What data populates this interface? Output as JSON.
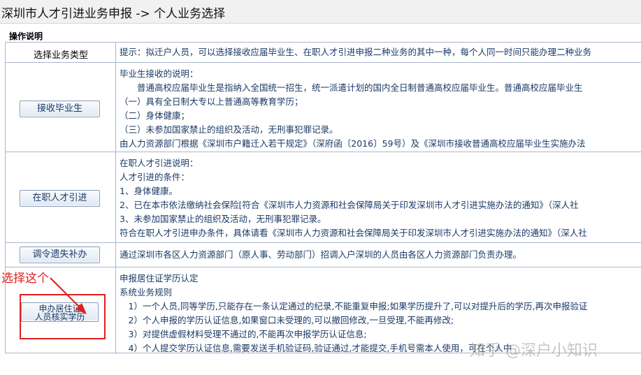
{
  "page": {
    "title": "深圳市人才引进业务申报 -> 个人业务选择",
    "section_label": "操作说明"
  },
  "header_row": {
    "left": "选择业务类型",
    "right": "提示：拟迁户人员，可以选择接收应届毕业生、在职人才引进申报二种业务的其中一种，每个人同一时间只能办理二种业务"
  },
  "rows": [
    {
      "button": "接收毕业生",
      "lines": [
        "毕业生接收的说明：",
        "　　普通高校应届毕业生是指纳入全国统一招生，统一派遣计划的国内全日制普通高校应届毕业生。普通高校应届毕业生",
        "（一）具有全日制大专以上普通高等教育学历；",
        "（二）身体健康；",
        "（三）未参加国家禁止的组织及活动，无刑事犯罪记录。",
        "由人力资源部门根据《深圳市户籍迁入若干规定》（深府函〔2016〕59号）及《深圳市接收普通高校应届毕业生实施办法"
      ]
    },
    {
      "button": "在职人才引进",
      "lines": [
        "在职人才引进说明：",
        "人才引进的条件：",
        "1、身体健康。",
        "2、已在本市依法缴纳社会保险[符合《深圳市人力资源和社会保障局关于印发深圳市人才引进实施办法的通知》（深人社",
        "3、未参加国家禁止的组织及活动，无刑事犯罪记录。",
        "符合在职人才引进申办条件，具体请看《深圳市人力资源和社会保障局关于印发深圳市人才引进实施办法的通知》（深人社"
      ]
    },
    {
      "button": "调令遗失补办",
      "lines": [
        "通过深圳市各区人力资源部门（原人事、劳动部门）招调入户深圳的人员由各区人力资源部门负责办理。"
      ]
    },
    {
      "button_line1": "申办居住证",
      "button_line2": "人员核实学历",
      "lines": [
        "申报居住证学历认定",
        "系统业务规则",
        "　1）一个人员,同等学历,只能存在一条认定通过的纪录,不能重复申报;如果学历提升了,可以对提升后的学历,再次申报验证",
        "　2）个人申报的学历认证信息,如果窗口未受理的,可以撤回修改,一旦受理,不能再修改;",
        "　3）对提供虚假材料受理不通过的,不能再次申报学历认证信息;",
        "　4）个人提交学历认证信息,需要发送手机验证码,验证通过,才能提交,手机号需本人使用，可在个人中"
      ]
    }
  ],
  "annotation": {
    "text": "选择这个",
    "color": "#e02020"
  },
  "watermark": "知乎 @深户小知识"
}
